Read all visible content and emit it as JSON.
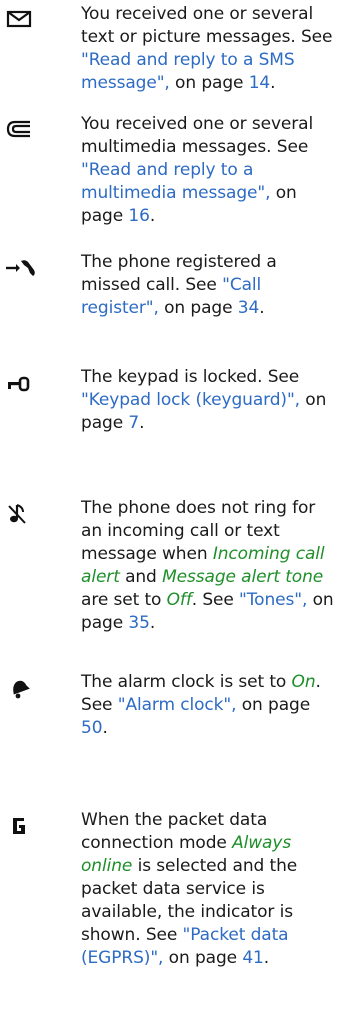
{
  "entries": [
    {
      "icon": "envelope-icon",
      "parts": [
        "You received one or several text or picture messages. See ",
        "\"Read and reply to a SMS message\",",
        " on page ",
        "14",
        "."
      ]
    },
    {
      "icon": "multimedia-message-icon",
      "parts": [
        "You received one or several multimedia messages. See ",
        "\"Read and reply to a multimedia message\",",
        " on page ",
        "16",
        "."
      ]
    },
    {
      "icon": "missed-call-icon",
      "parts": [
        "The phone registered a missed call. See ",
        "\"Call register\",",
        " on page ",
        "34",
        "."
      ]
    },
    {
      "icon": "keypad-lock-icon",
      "parts": [
        "The keypad is locked. See ",
        "\"Keypad lock (keyguard)\",",
        " on page ",
        "7",
        "."
      ]
    },
    {
      "icon": "silent-icon",
      "parts": [
        "The phone does not ring for an incoming call or text message when ",
        "Incoming call alert",
        " and ",
        "Message alert tone",
        " are set to ",
        "Off",
        ". See ",
        "\"Tones\",",
        " on page ",
        "35",
        "."
      ]
    },
    {
      "icon": "alarm-clock-icon",
      "parts": [
        "The alarm clock is set to ",
        "On",
        ". See ",
        "\"Alarm clock\",",
        " on page ",
        "50",
        "."
      ]
    },
    {
      "icon": "packet-data-icon",
      "parts": [
        "When the packet data connection mode ",
        "Always online",
        " is selected and the packet data service is available, the indicator is shown. See ",
        "\"Packet data (EGPRS)\",",
        " on page ",
        "41",
        "."
      ]
    }
  ]
}
